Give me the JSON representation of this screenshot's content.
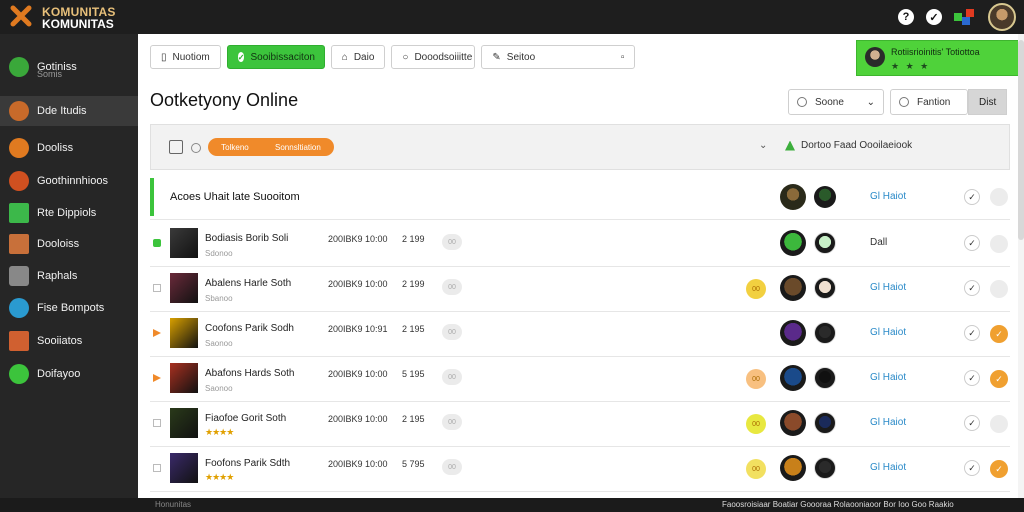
{
  "app": {
    "logo_line1": "KOMUNITAS",
    "logo_line2": "KOMUNITAS",
    "help_icon": "question-icon",
    "support_icon": "help-icon",
    "colors": {
      "sidebar": "#262626",
      "topbar": "#1e1e1e",
      "accent_green": "#3cc43c",
      "accent_orange": "#f08a2a",
      "link_blue": "#2a8ac8"
    }
  },
  "sidebar": {
    "items": [
      {
        "label": "Gotiniss",
        "sub": "Somis",
        "icon": "globe-icon",
        "color": "#3aa83a"
      },
      {
        "label": "Dde Itudis",
        "icon": "avatar-icon",
        "color": "#c86a2a"
      },
      {
        "label": "Dooliss",
        "icon": "game-icon",
        "color": "#e07a20"
      },
      {
        "label": "Goothinnhioos",
        "icon": "fire-icon",
        "color": "#d05020"
      },
      {
        "label": "Rte Dippiols",
        "icon": "chart-icon",
        "color": "#3cb84a"
      },
      {
        "label": "Dooloiss",
        "icon": "book-icon",
        "color": "#c8703a"
      },
      {
        "label": "Raphals",
        "icon": "phone-icon",
        "color": "#888888"
      },
      {
        "label": "Fise Bompots",
        "icon": "earth-icon",
        "color": "#2a9ad0"
      },
      {
        "label": "Sooiiatos",
        "icon": "image-icon",
        "color": "#d06030"
      },
      {
        "label": "Doifayoo",
        "icon": "refresh-icon",
        "color": "#3cc43c"
      }
    ]
  },
  "tabs": [
    {
      "label": "Nuotiom",
      "icon": "book-icon"
    },
    {
      "label": "Sooibissaciton",
      "icon": "check-icon"
    },
    {
      "label": "Daio",
      "icon": "bag-icon"
    },
    {
      "label": "Dooodsoiiitte",
      "icon": "circle-icon"
    },
    {
      "label": "Seitoo",
      "icon": "edit-icon"
    }
  ],
  "notification": {
    "title": "Rotiisrioinitis' Totiottoa",
    "dots": "★ ★ ★"
  },
  "page": {
    "title": "Ootketyony Online"
  },
  "controls": {
    "select_label": "Soone",
    "search_label": "Fantion",
    "button_label": "Dist"
  },
  "filterbar": {
    "pill_left": "Tolkeno",
    "pill_right": "Sonnsltiation",
    "sort_label": "Dortoo Faad Oooilaeiook"
  },
  "table": {
    "header_title": "Acoes Uhait late Suooitom",
    "header_link": "Gl Haiot",
    "rows": [
      {
        "name": "Bodiasis Borib Soli",
        "sub": "Sdonoo",
        "stars": "",
        "date": "200IBK9 10:00",
        "num": "2 199",
        "pill": "00",
        "badge": "",
        "badge_color": "",
        "link": "Dall",
        "link_style": "dark",
        "end": "",
        "mark": "green",
        "thumb": "#3a3a3a",
        "av1": "#3cb83c",
        "av2": "#c8f0c8"
      },
      {
        "name": "Abalens Harle Soth",
        "sub": "Sbanoo",
        "stars": "",
        "date": "200IBK9 10:00",
        "num": "2 199",
        "pill": "00",
        "badge": "00",
        "badge_color": "#f2d040",
        "link": "Gl Haiot",
        "link_style": "blue",
        "end": "",
        "mark": "",
        "thumb": "#6a2a3a",
        "av1": "#6a4a2a",
        "av2": "#f0e0d0"
      },
      {
        "name": "Coofons Parik Sodh",
        "sub": "Saonoo",
        "stars": "",
        "date": "200IBK9 10:91",
        "num": "2 195",
        "pill": "00",
        "badge": "",
        "badge_color": "",
        "link": "Gl Haiot",
        "link_style": "blue",
        "end": "✓",
        "mark": "orange",
        "thumb": "#d8a000",
        "av1": "#5a2a8a",
        "av2": "#2a2a2a"
      },
      {
        "name": "Abafons Hards Soth",
        "sub": "Saonoo",
        "stars": "",
        "date": "200IBK9 10:00",
        "num": "5 195",
        "pill": "00",
        "badge": "00",
        "badge_color": "#f8c080",
        "link": "Gl Haiot",
        "link_style": "blue",
        "end": "✓",
        "mark": "orange",
        "thumb": "#a83020",
        "av1": "#1a4a8a",
        "av2": "#101010"
      },
      {
        "name": "Fiaofoe Gorit Soth",
        "sub": "",
        "stars": "★★★★",
        "date": "200IBK9 10:00",
        "num": "2 195",
        "pill": "00",
        "badge": "00",
        "badge_color": "#e8e840",
        "link": "Gl Haiot",
        "link_style": "blue",
        "end": "",
        "mark": "",
        "thumb": "#2a3a1a",
        "av1": "#8a4a2a",
        "av2": "#1a2a5a"
      },
      {
        "name": "Foofons Parik Sdth",
        "sub": "",
        "stars": "★★★★",
        "date": "200IBK9 10:00",
        "num": "5 795",
        "pill": "00",
        "badge": "00",
        "badge_color": "#f2e060",
        "link": "Gl Haiot",
        "link_style": "blue",
        "end": "✓",
        "mark": "",
        "thumb": "#3a2a6a",
        "av1": "#c8801a",
        "av2": "#2a2a2a"
      }
    ]
  },
  "footer": {
    "left": "Honunitas",
    "right": "Faoosroisiaar Boatiar Goooraa Rolaooniaoor Bor Ioo Goo Raakio"
  }
}
